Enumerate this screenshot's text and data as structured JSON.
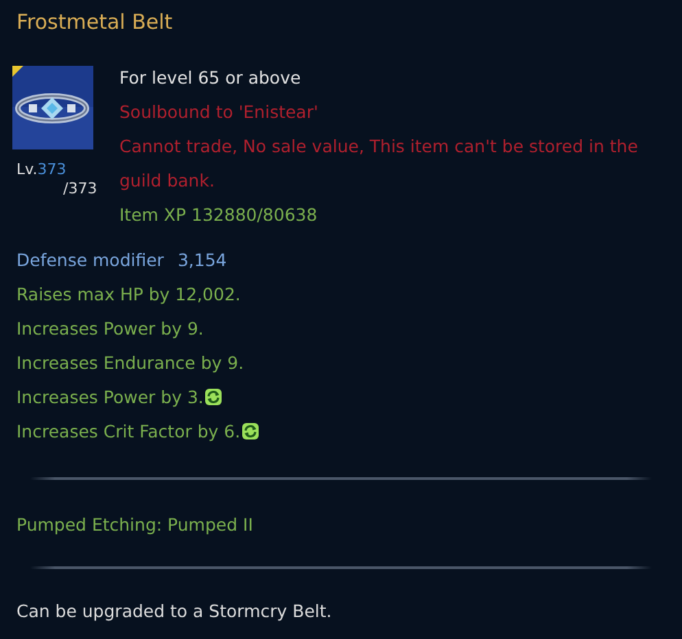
{
  "title": "Frostmetal Belt",
  "item": {
    "kind": "picture",
    "level": "373",
    "max_level": "/373",
    "level_prefix": "Lv."
  },
  "info_lines": [
    {
      "kind": "requirement",
      "text": "For level 65 or above"
    },
    {
      "kind": "warning",
      "text": "Soulbound to 'Enistear'"
    },
    {
      "kind": "warning",
      "text": "Cannot trade, No sale value, This item can't be stored in the guild bank."
    },
    {
      "kind": "bonus",
      "text": "Item XP 132880/80638"
    }
  ],
  "stats": [
    {
      "kind": "defense",
      "label": "Defense modifier",
      "value": "3,154"
    },
    {
      "kind": "bonus",
      "text": "Raises max HP by 12,002.",
      "etched": false
    },
    {
      "kind": "bonus",
      "text": "Increases Power by 9.",
      "etched": false
    },
    {
      "kind": "bonus",
      "text": "Increases Endurance by 9.",
      "etched": false
    },
    {
      "kind": "bonus",
      "text": "Increases Power by 3.",
      "etched": true
    },
    {
      "kind": "bonus",
      "text": "Increases Crit Factor by 6.",
      "etched": true
    }
  ],
  "etching": "Pumped Etching: Pumped II",
  "upgrade_note": "Can be upgraded to a Stormcry Belt."
}
